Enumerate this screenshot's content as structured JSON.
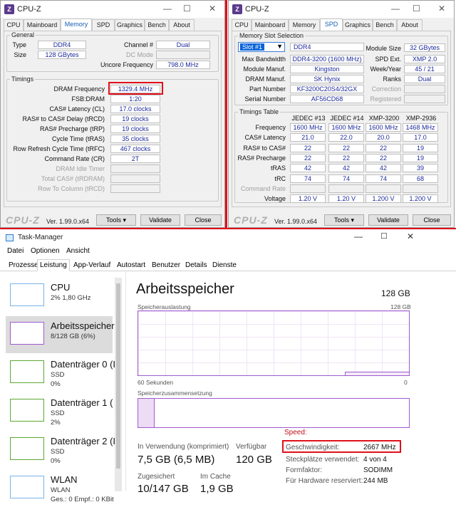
{
  "cpuz_memory": {
    "title": "CPU-Z",
    "tabs": [
      "CPU",
      "Mainboard",
      "Memory",
      "SPD",
      "Graphics",
      "Bench",
      "About"
    ],
    "active_tab": "Memory",
    "general_label": "General",
    "type_label": "Type",
    "type_value": "DDR4",
    "size_label": "Size",
    "size_value": "128 GBytes",
    "channel_label": "Channel #",
    "channel_value": "Dual",
    "dcmode_label": "DC Mode",
    "dcmode_value": "",
    "uncore_label": "Uncore Frequency",
    "uncore_value": "798.0 MHz",
    "timings_label": "Timings",
    "timings": [
      {
        "label": "DRAM Frequency",
        "value": "1329.4 MHz",
        "disabled": false
      },
      {
        "label": "FSB:DRAM",
        "value": "1:20",
        "disabled": false
      },
      {
        "label": "CAS# Latency (CL)",
        "value": "17.0 clocks",
        "disabled": false
      },
      {
        "label": "RAS# to CAS# Delay (tRCD)",
        "value": "19 clocks",
        "disabled": false
      },
      {
        "label": "RAS# Precharge (tRP)",
        "value": "19 clocks",
        "disabled": false
      },
      {
        "label": "Cycle Time (tRAS)",
        "value": "35 clocks",
        "disabled": false
      },
      {
        "label": "Row Refresh Cycle Time (tRFC)",
        "value": "467 clocks",
        "disabled": false
      },
      {
        "label": "Command Rate (CR)",
        "value": "2T",
        "disabled": false
      },
      {
        "label": "DRAM Idle Timer",
        "value": "",
        "disabled": true
      },
      {
        "label": "Total CAS# (tRDRAM)",
        "value": "",
        "disabled": true
      },
      {
        "label": "Row To Column (tRCD)",
        "value": "",
        "disabled": true
      }
    ],
    "logo": "CPU-Z",
    "version": "Ver. 1.99.0.x64",
    "tools_label": "Tools",
    "validate_label": "Validate",
    "close_label": "Close"
  },
  "cpuz_spd": {
    "title": "CPU-Z",
    "tabs": [
      "CPU",
      "Mainboard",
      "Memory",
      "SPD",
      "Graphics",
      "Bench",
      "About"
    ],
    "active_tab": "SPD",
    "slot_group_label": "Memory Slot Selection",
    "slot_value": "Slot #1",
    "slot_type": "DDR4",
    "module_size_label": "Module Size",
    "module_size_value": "32 GBytes",
    "max_bw_label": "Max Bandwidth",
    "max_bw_value": "DDR4-3200 (1600 MHz)",
    "spd_ext_label": "SPD Ext.",
    "spd_ext_value": "XMP 2.0",
    "module_manuf_label": "Module Manuf.",
    "module_manuf_value": "Kingston",
    "week_year_label": "Week/Year",
    "week_year_value": "45 / 21",
    "dram_manuf_label": "DRAM Manuf.",
    "dram_manuf_value": "SK Hynix",
    "ranks_label": "Ranks",
    "ranks_value": "Dual",
    "part_label": "Part Number",
    "part_value": "KF3200C20S4/32GX",
    "correction_label": "Correction",
    "correction_value": "",
    "serial_label": "Serial Number",
    "serial_value": "AF56CD68",
    "registered_label": "Registered",
    "registered_value": "",
    "timings_table_label": "Timings Table",
    "columns": [
      "JEDEC #13",
      "JEDEC #14",
      "XMP-3200",
      "XMP-2936"
    ],
    "rows": [
      {
        "label": "Frequency",
        "values": [
          "1600 MHz",
          "1600 MHz",
          "1600 MHz",
          "1468 MHz"
        ],
        "disabled": false
      },
      {
        "label": "CAS# Latency",
        "values": [
          "21.0",
          "22.0",
          "20.0",
          "17.0"
        ],
        "disabled": false
      },
      {
        "label": "RAS# to CAS#",
        "values": [
          "22",
          "22",
          "22",
          "19"
        ],
        "disabled": false
      },
      {
        "label": "RAS# Precharge",
        "values": [
          "22",
          "22",
          "22",
          "19"
        ],
        "disabled": false
      },
      {
        "label": "tRAS",
        "values": [
          "42",
          "42",
          "42",
          "39"
        ],
        "disabled": false
      },
      {
        "label": "tRC",
        "values": [
          "74",
          "74",
          "74",
          "68"
        ],
        "disabled": false
      },
      {
        "label": "Command Rate",
        "values": [
          "",
          "",
          "",
          ""
        ],
        "disabled": true
      },
      {
        "label": "Voltage",
        "values": [
          "1.20 V",
          "1.20 V",
          "1.200 V",
          "1.200 V"
        ],
        "disabled": false
      }
    ],
    "logo": "CPU-Z",
    "version": "Ver. 1.99.0.x64",
    "tools_label": "Tools",
    "validate_label": "Validate",
    "close_label": "Close"
  },
  "taskmgr": {
    "title": "Task-Manager",
    "menu": [
      "Datei",
      "Optionen",
      "Ansicht"
    ],
    "tabs": [
      "Prozesse",
      "Leistung",
      "App-Verlauf",
      "Autostart",
      "Benutzer",
      "Details",
      "Dienste"
    ],
    "active_tab": "Leistung",
    "sidebar": [
      {
        "title": "CPU",
        "sub1": "2% 1,80 GHz",
        "sub2": ""
      },
      {
        "title": "Arbeitsspeicher",
        "sub1": "8/128 GB (6%)",
        "sub2": ""
      },
      {
        "title": "Datenträger 0 (I",
        "sub1": "SSD",
        "sub2": "0%"
      },
      {
        "title": "Datenträger 1 (",
        "sub1": "SSD",
        "sub2": "2%"
      },
      {
        "title": "Datenträger 2 (I",
        "sub1": "SSD",
        "sub2": "0%"
      },
      {
        "title": "WLAN",
        "sub1": "WLAN",
        "sub2": "Ges.: 0 Empf.: 0 KBit"
      }
    ],
    "heading": "Arbeitsspeicher",
    "total": "128 GB",
    "usage_label": "Speicherauslastung",
    "usage_max": "128 GB",
    "time_left": "60 Sekunden",
    "time_right": "0",
    "composition_label": "Speicherzusammensetzung",
    "in_use_label": "In Verwendung (komprimiert)",
    "in_use_value": "7,5 GB (6,5 MB)",
    "available_label": "Verfügbar",
    "available_value": "120 GB",
    "committed_label": "Zugesichert",
    "committed_value": "10/147 GB",
    "cached_label": "Im Cache",
    "cached_value": "1,9 GB",
    "speed_header": "Speed:",
    "speed_label": "Geschwindigkeit:",
    "speed_value": "2667 MHz",
    "slots_label": "Steckplätze verwendet:",
    "slots_value": "4 von 4",
    "form_label": "Formfaktor:",
    "form_value": "SODIMM",
    "reserved_label": "Für Hardware reserviert:",
    "reserved_value": "244 MB",
    "usage_fraction": 0.06
  },
  "colors": {
    "accent_red": "#e0101a",
    "cpuz_value_blue": "#1c2a9c",
    "tm_memory_purple": "#a05ad0",
    "tm_speed_red": "#c0101a"
  }
}
